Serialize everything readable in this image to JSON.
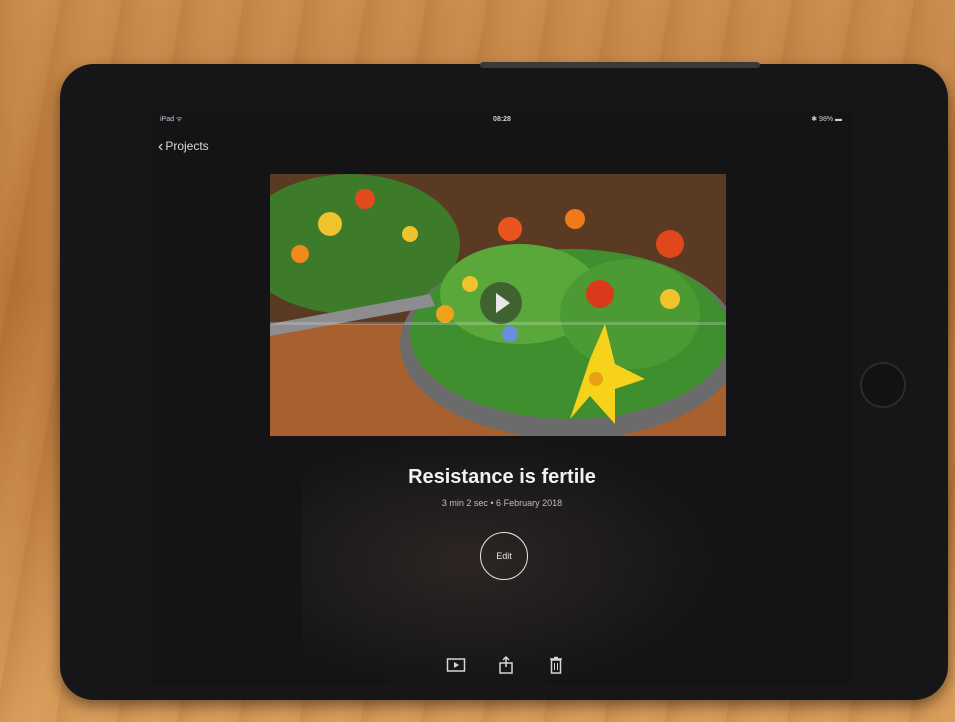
{
  "status_bar": {
    "left": "iPad ᯤ",
    "time": "08:28",
    "right": "✱ 98% ▬"
  },
  "nav": {
    "back_label": "Projects"
  },
  "project": {
    "title": "Resistance is fertile",
    "meta": "3 min 2 sec • 6 February 2018"
  },
  "actions": {
    "edit_label": "Edit"
  },
  "toolbar": {
    "icons": [
      "play-preview-icon",
      "share-icon",
      "trash-icon"
    ]
  },
  "colors": {
    "screen_bg": "#141416",
    "case": "#161618",
    "wood": "#c98a4a"
  }
}
